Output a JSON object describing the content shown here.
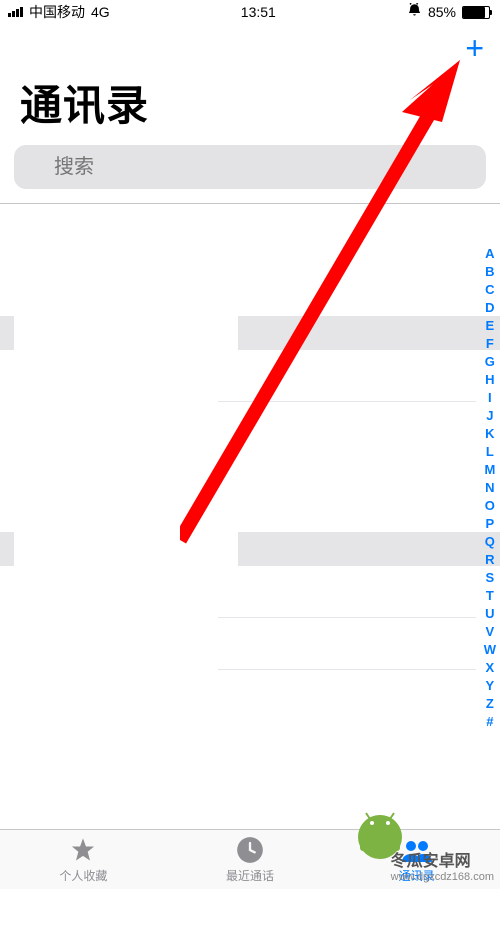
{
  "status": {
    "carrier": "中国移动",
    "network": "4G",
    "time": "13:51",
    "battery_percent": "85%"
  },
  "nav": {
    "add_label": "+"
  },
  "title": "通讯录",
  "search": {
    "placeholder": "搜索"
  },
  "index_letters": [
    "A",
    "B",
    "C",
    "D",
    "E",
    "F",
    "G",
    "H",
    "I",
    "J",
    "K",
    "L",
    "M",
    "N",
    "O",
    "P",
    "Q",
    "R",
    "S",
    "T",
    "U",
    "V",
    "W",
    "X",
    "Y",
    "Z",
    "#"
  ],
  "tabs": [
    {
      "label": "个人收藏",
      "icon": "star",
      "active": false
    },
    {
      "label": "最近通话",
      "icon": "clock",
      "active": false
    },
    {
      "label": "通讯录",
      "icon": "contacts",
      "active": true
    }
  ],
  "watermark": {
    "brand": "冬瓜安卓网",
    "url": "www.dgxcdz168.com"
  },
  "annotation": {
    "arrow_color": "#ff0000"
  }
}
